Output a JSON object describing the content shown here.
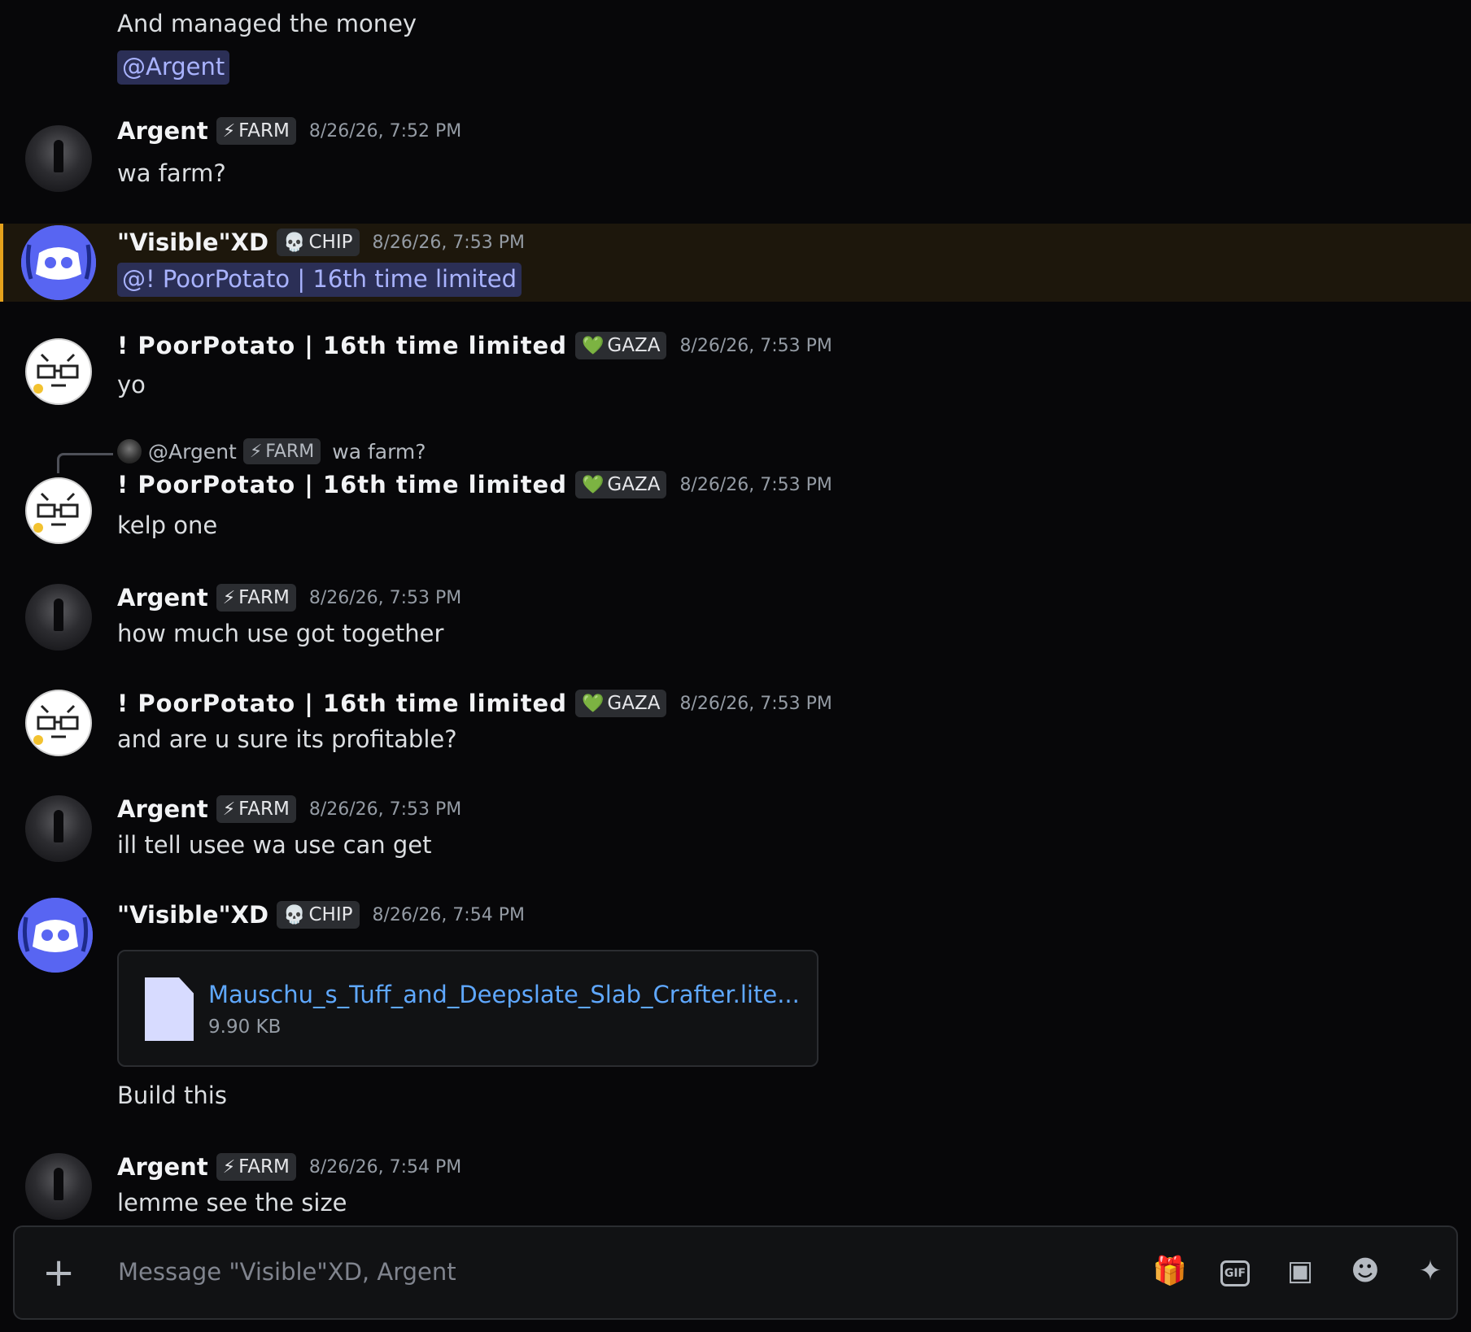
{
  "messages": {
    "m0": {
      "line1": "And managed the money",
      "mention": "@Argent"
    },
    "m1": {
      "user": "Argent",
      "tag": "FARM",
      "tag_icon": "⚡",
      "time": "8/26/26, 7:52 PM",
      "text": "wa farm?"
    },
    "m2": {
      "user": "\"Visible\"XD",
      "tag": "CHIP",
      "tag_icon": "💀",
      "time": "8/26/26, 7:53 PM",
      "mention": "@! PoorPotato | 16th time limited"
    },
    "m3": {
      "user": "! PoorPotato | 16th time limited",
      "tag": "GAZA",
      "tag_icon": "💚",
      "time": "8/26/26, 7:53 PM",
      "text": "yo"
    },
    "m4": {
      "reply": {
        "mention": "@Argent",
        "tag": "FARM",
        "tag_icon": "⚡",
        "text": "wa farm?"
      },
      "user": "! PoorPotato | 16th time limited",
      "tag": "GAZA",
      "tag_icon": "💚",
      "time": "8/26/26, 7:53 PM",
      "text": "kelp one"
    },
    "m5": {
      "user": "Argent",
      "tag": "FARM",
      "tag_icon": "⚡",
      "time": "8/26/26, 7:53 PM",
      "text": "how much use got together"
    },
    "m6": {
      "user": "! PoorPotato | 16th time limited",
      "tag": "GAZA",
      "tag_icon": "💚",
      "time": "8/26/26, 7:53 PM",
      "text": "and are u sure its profitable?"
    },
    "m7": {
      "user": "Argent",
      "tag": "FARM",
      "tag_icon": "⚡",
      "time": "8/26/26, 7:53 PM",
      "text": "ill tell usee wa use can get"
    },
    "m8": {
      "user": "\"Visible\"XD",
      "tag": "CHIP",
      "tag_icon": "💀",
      "time": "8/26/26, 7:54 PM",
      "attachment": {
        "name": "Mauschu_s_Tuff_and_Deepslate_Slab_Crafter.lite...",
        "size": "9.90 KB"
      },
      "text": "Build this"
    },
    "m9": {
      "user": "Argent",
      "tag": "FARM",
      "tag_icon": "⚡",
      "time": "8/26/26, 7:54 PM",
      "text": "lemme see the size"
    }
  },
  "composer": {
    "placeholder": "Message \"Visible\"XD, Argent",
    "plus": "+",
    "tools": {
      "gift": "🎁",
      "gif": "GIF",
      "sticker": "▣",
      "emoji": "☻",
      "apps": "✦"
    }
  },
  "colors": {
    "highlight_bar": "#e5a21c",
    "mention_bg": "#2b2f56",
    "mention_fg": "#a9b3ff",
    "link": "#5fa8ff"
  }
}
